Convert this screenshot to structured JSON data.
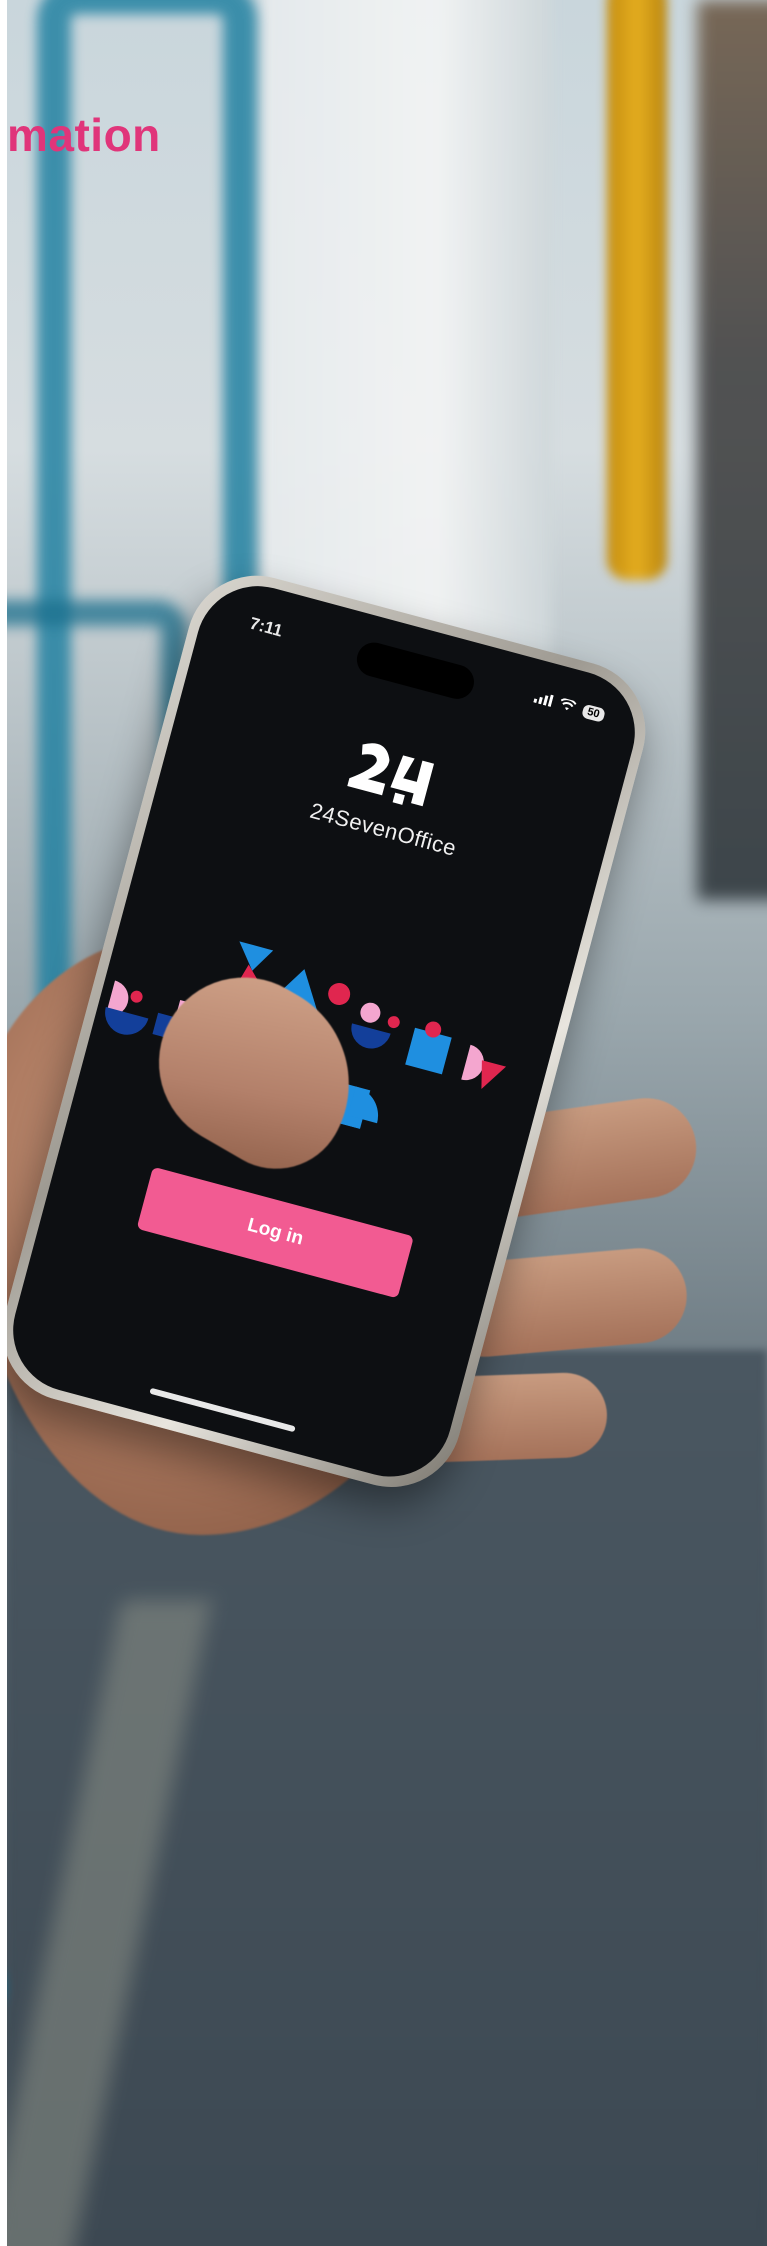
{
  "headline": {
    "text": "mation"
  },
  "phone": {
    "status_time": "7:11",
    "battery": "50",
    "brand_name": "24SevenOffice",
    "login_label": "Log in"
  },
  "colors": {
    "accent_pink": "#e0357a",
    "button_pink": "#f25b92",
    "pattern_blue": "#1f8fe0",
    "pattern_navy": "#133f9a",
    "pattern_red": "#e0264f",
    "pattern_light_pink": "#f4a6cf"
  },
  "icons": {
    "signal": "cell-signal-icon",
    "wifi": "wifi-icon",
    "battery": "battery-icon",
    "logo": "24sevenoffice-logo"
  }
}
